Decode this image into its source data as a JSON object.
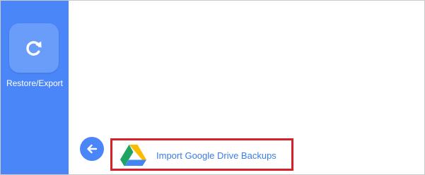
{
  "sidebar": {
    "item_label": "Restore/Export",
    "item_icon": "refresh-icon",
    "color": "#4a86f7"
  },
  "main": {
    "back_icon": "arrow-left-icon",
    "import_option": {
      "label": "Import Google Drive Backups",
      "icon": "google-drive-icon",
      "highlight_color": "#d6212b",
      "label_color": "#3a7de8"
    }
  }
}
